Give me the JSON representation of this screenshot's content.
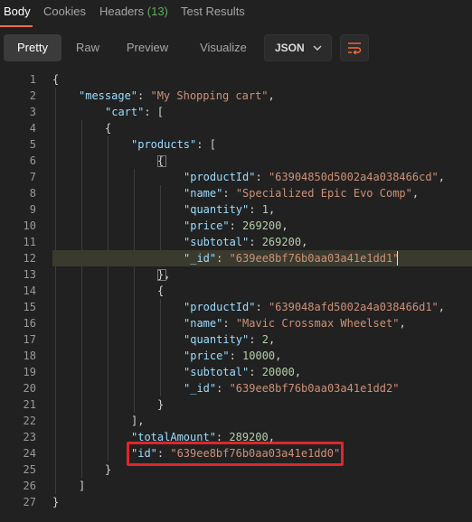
{
  "tabs": [
    {
      "label": "Body"
    },
    {
      "label": "Cookies"
    },
    {
      "label": "Headers",
      "count": "(13)"
    },
    {
      "label": "Test Results"
    }
  ],
  "toolbar": {
    "views": [
      "Pretty",
      "Raw",
      "Preview",
      "Visualize"
    ],
    "active_view": "Pretty",
    "format": "JSON",
    "accent": "#ff6c37"
  },
  "code": {
    "line_numbers": [
      "1",
      "2",
      "3",
      "4",
      "5",
      "6",
      "7",
      "8",
      "9",
      "10",
      "11",
      "12",
      "13",
      "14",
      "15",
      "16",
      "17",
      "18",
      "19",
      "20",
      "21",
      "22",
      "23",
      "24",
      "25",
      "26",
      "27"
    ],
    "lines": [
      [
        [
          "p",
          "{"
        ]
      ],
      [
        [
          "k",
          "\"message\""
        ],
        [
          "p",
          ": "
        ],
        [
          "s",
          "\"My Shopping cart\""
        ],
        [
          "p",
          ","
        ]
      ],
      [
        [
          "k",
          "\"cart\""
        ],
        [
          "p",
          ": ["
        ]
      ],
      [
        [
          "p",
          "{"
        ]
      ],
      [
        [
          "k",
          "\"products\""
        ],
        [
          "p",
          ": ["
        ]
      ],
      [
        [
          "p",
          "{"
        ]
      ],
      [
        [
          "k",
          "\"productId\""
        ],
        [
          "p",
          ": "
        ],
        [
          "s",
          "\"63904850d5002a4a038466cd\""
        ],
        [
          "p",
          ","
        ]
      ],
      [
        [
          "k",
          "\"name\""
        ],
        [
          "p",
          ": "
        ],
        [
          "s",
          "\"Specialized Epic Evo Comp\""
        ],
        [
          "p",
          ","
        ]
      ],
      [
        [
          "k",
          "\"quantity\""
        ],
        [
          "p",
          ": "
        ],
        [
          "n",
          "1"
        ],
        [
          "p",
          ","
        ]
      ],
      [
        [
          "k",
          "\"price\""
        ],
        [
          "p",
          ": "
        ],
        [
          "n",
          "269200"
        ],
        [
          "p",
          ","
        ]
      ],
      [
        [
          "k",
          "\"subtotal\""
        ],
        [
          "p",
          ": "
        ],
        [
          "n",
          "269200"
        ],
        [
          "p",
          ","
        ]
      ],
      [
        [
          "k",
          "\"_id\""
        ],
        [
          "p",
          ": "
        ],
        [
          "s",
          "\"639ee8bf76b0aa03a41e1dd1\""
        ]
      ],
      [
        [
          "p",
          "},"
        ]
      ],
      [
        [
          "p",
          "{"
        ]
      ],
      [
        [
          "k",
          "\"productId\""
        ],
        [
          "p",
          ": "
        ],
        [
          "s",
          "\"639048afd5002a4a038466d1\""
        ],
        [
          "p",
          ","
        ]
      ],
      [
        [
          "k",
          "\"name\""
        ],
        [
          "p",
          ": "
        ],
        [
          "s",
          "\"Mavic Crossmax Wheelset\""
        ],
        [
          "p",
          ","
        ]
      ],
      [
        [
          "k",
          "\"quantity\""
        ],
        [
          "p",
          ": "
        ],
        [
          "n",
          "2"
        ],
        [
          "p",
          ","
        ]
      ],
      [
        [
          "k",
          "\"price\""
        ],
        [
          "p",
          ": "
        ],
        [
          "n",
          "10000"
        ],
        [
          "p",
          ","
        ]
      ],
      [
        [
          "k",
          "\"subtotal\""
        ],
        [
          "p",
          ": "
        ],
        [
          "n",
          "20000"
        ],
        [
          "p",
          ","
        ]
      ],
      [
        [
          "k",
          "\"_id\""
        ],
        [
          "p",
          ": "
        ],
        [
          "s",
          "\"639ee8bf76b0aa03a41e1dd2\""
        ]
      ],
      [
        [
          "p",
          "}"
        ]
      ],
      [
        [
          "p",
          "],"
        ]
      ],
      [
        [
          "k",
          "\"totalAmount\""
        ],
        [
          "p",
          ": "
        ],
        [
          "n",
          "289200"
        ],
        [
          "p",
          ","
        ]
      ],
      [
        [
          "k",
          "\"id\""
        ],
        [
          "p",
          ": "
        ],
        [
          "s",
          "\"639ee8bf76b0aa03a41e1dd0\""
        ]
      ],
      [
        [
          "p",
          "}"
        ]
      ],
      [
        [
          "p",
          "]"
        ]
      ],
      [
        [
          "p",
          "}"
        ]
      ]
    ]
  }
}
